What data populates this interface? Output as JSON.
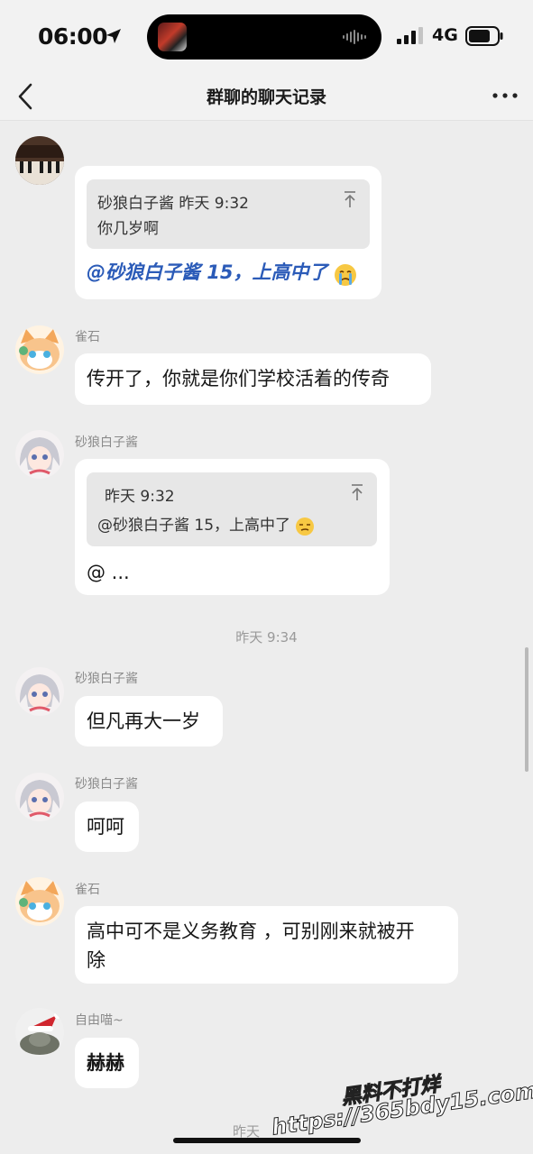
{
  "status": {
    "time": "06:00",
    "network": "4G"
  },
  "nav": {
    "title": "群聊的聊天记录"
  },
  "messages": [
    {
      "quote_head": "砂狼白子酱  昨天 9:32",
      "quote_body": "你几岁啊",
      "text": "@砂狼白子酱 15，上高中了"
    },
    {
      "sender": "雀石",
      "text": "传开了，你就是你们学校活着的传奇"
    },
    {
      "sender": "砂狼白子酱",
      "quote_head": "昨天 9:32",
      "quote_body": "@砂狼白子酱 15，上高中了",
      "text": "@ ..."
    },
    {
      "sender": "砂狼白子酱",
      "text": "但凡再大一岁"
    },
    {
      "sender": "砂狼白子酱",
      "text": "呵呵"
    },
    {
      "sender": "雀石",
      "text_line1": "高中可不是义务教育 ，可别刚来就被开",
      "text_line2": "除"
    },
    {
      "sender": "自由喵~",
      "text": "赫赫"
    }
  ],
  "time_separators": [
    "昨天 9:34",
    "昨天"
  ],
  "watermark": {
    "line1": "黑料不打烊",
    "line2": "https://365bdy15.com"
  },
  "colors": {
    "background": "#ededed",
    "bubble": "#ffffff",
    "mention": "#2b5bb8",
    "quote_bg": "#e7e7e7"
  },
  "icons": [
    "location-arrow-icon",
    "signal-icon",
    "battery-icon",
    "back-chevron-icon",
    "more-dots-icon",
    "pin-top-icon",
    "crying-emoji-icon",
    "smirk-emoji-icon"
  ]
}
